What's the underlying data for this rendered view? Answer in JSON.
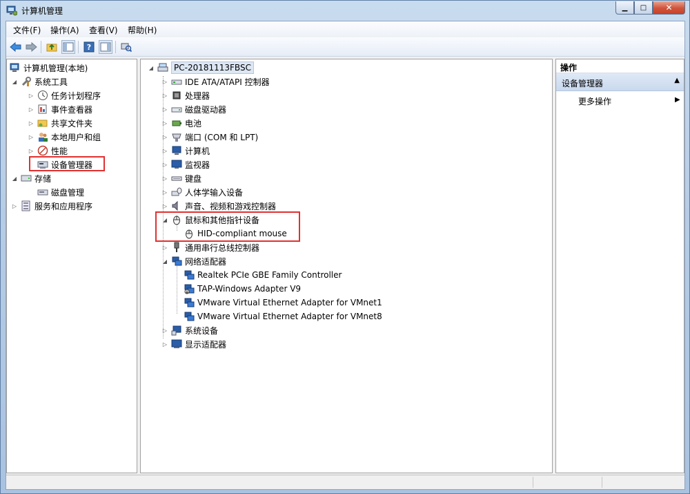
{
  "window": {
    "title": "计算机管理",
    "min_symbol": "▁",
    "max_symbol": "□",
    "close_symbol": "✕"
  },
  "menu": [
    "文件(F)",
    "操作(A)",
    "查看(V)",
    "帮助(H)"
  ],
  "left_tree": {
    "root": "计算机管理(本地)",
    "system_tools": "系统工具",
    "task_scheduler": "任务计划程序",
    "event_viewer": "事件查看器",
    "shared_folders": "共享文件夹",
    "local_users": "本地用户和组",
    "performance": "性能",
    "device_manager": "设备管理器",
    "storage": "存储",
    "disk_management": "磁盘管理",
    "services_apps": "服务和应用程序"
  },
  "device_tree": {
    "computer": "PC-20181113FBSC",
    "ide": "IDE ATA/ATAPI 控制器",
    "processor": "处理器",
    "disk_drives": "磁盘驱动器",
    "battery": "电池",
    "ports": "端口 (COM 和 LPT)",
    "computer_cat": "计算机",
    "monitors": "监视器",
    "keyboards": "键盘",
    "hid": "人体学输入设备",
    "sound": "声音、视频和游戏控制器",
    "mice": "鼠标和其他指针设备",
    "mouse_device": "HID-compliant mouse",
    "usb": "通用串行总线控制器",
    "network": "网络适配器",
    "net1": "Realtek PCIe GBE Family Controller",
    "net2": "TAP-Windows Adapter V9",
    "net3": "VMware Virtual Ethernet Adapter for VMnet1",
    "net4": "VMware Virtual Ethernet Adapter for VMnet8",
    "system_devices": "系统设备",
    "display": "显示适配器"
  },
  "actions": {
    "header": "操作",
    "section": "设备管理器",
    "more": "更多操作"
  },
  "colors": {
    "highlight": "#e03030",
    "accent": "#c9d9ee"
  }
}
